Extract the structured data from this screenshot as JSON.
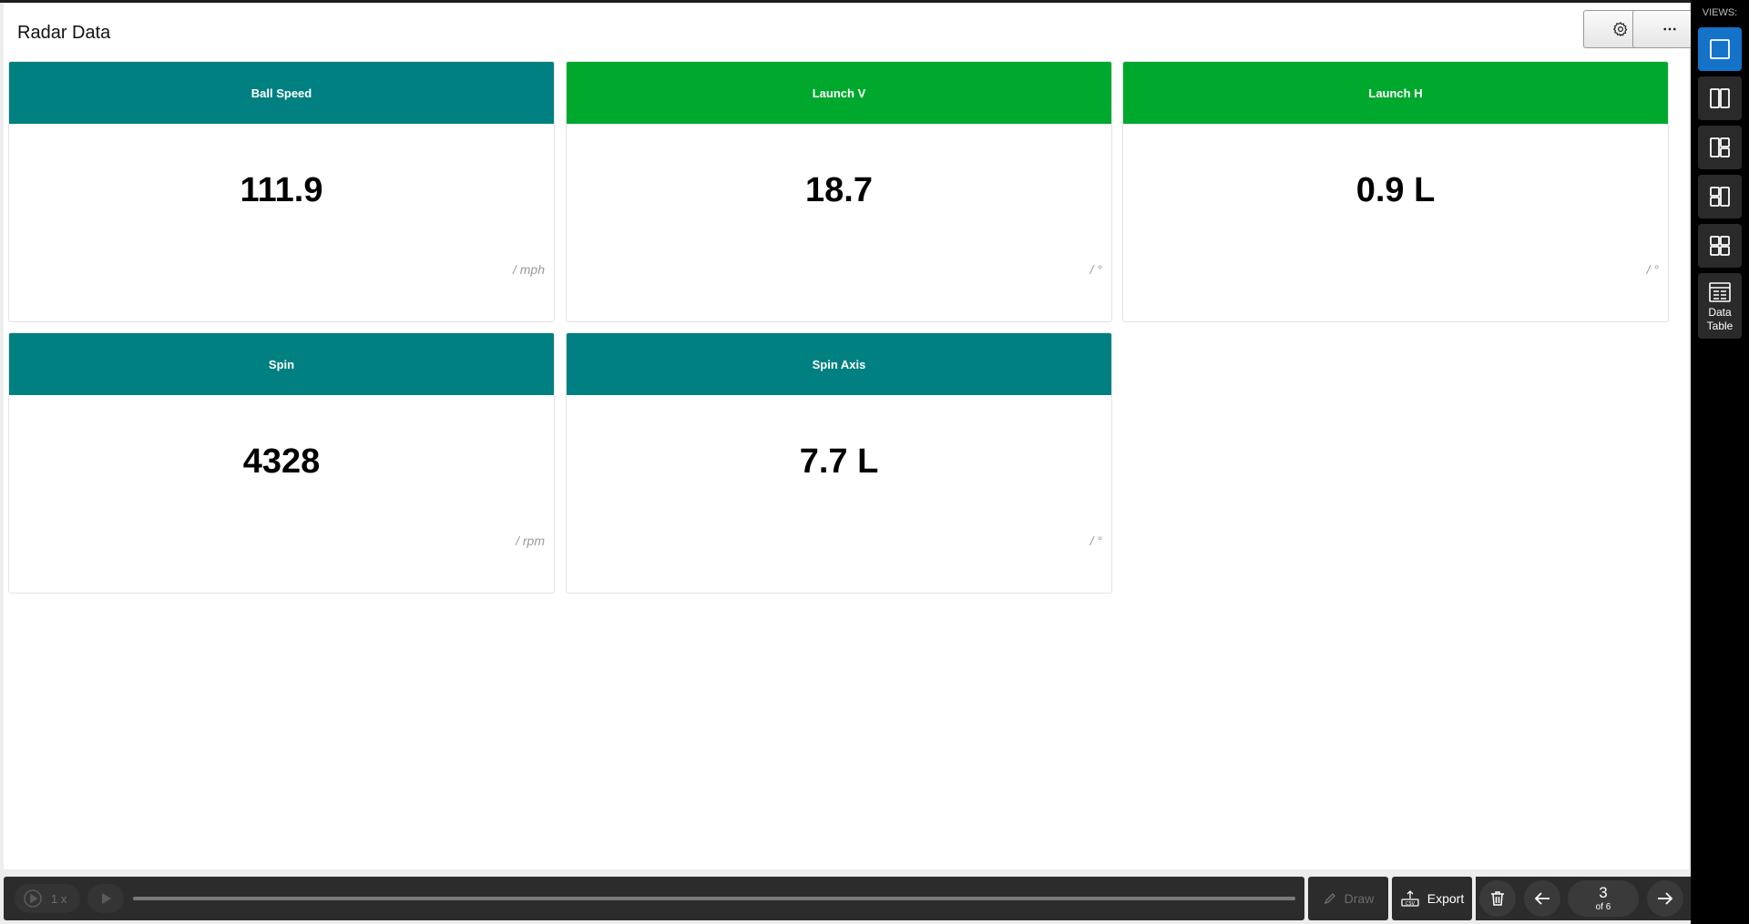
{
  "header": {
    "title": "Radar Data",
    "settings_icon": "gear-icon",
    "more_icon": "ellipsis-icon"
  },
  "cards": [
    {
      "label": "Ball Speed",
      "value": "111.9",
      "unit": "/ mph",
      "color": "#008080"
    },
    {
      "label": "Launch V",
      "value": "18.7",
      "unit": "/ °",
      "color": "#00a82d"
    },
    {
      "label": "Launch H",
      "value": "0.9 L",
      "unit": "/ °",
      "color": "#00a82d"
    },
    {
      "label": "Spin",
      "value": "4328",
      "unit": "/ rpm",
      "color": "#008080"
    },
    {
      "label": "Spin Axis",
      "value": "7.7 L",
      "unit": "/ °",
      "color": "#008080"
    }
  ],
  "sidebar": {
    "views_label": "VIEWS:",
    "views": [
      {
        "name": "single-view",
        "active": true
      },
      {
        "name": "two-column-view",
        "active": false
      },
      {
        "name": "split-left-view",
        "active": false
      },
      {
        "name": "split-right-view",
        "active": false
      },
      {
        "name": "grid-view",
        "active": false
      }
    ],
    "data_table_line1": "Data",
    "data_table_line2": "Table",
    "accent_color": "#1572c9"
  },
  "player": {
    "speed_label": "1 x"
  },
  "toolbar": {
    "draw_label": "Draw",
    "export_label": "Export"
  },
  "pager": {
    "current": "3",
    "total_label": "of 6"
  }
}
